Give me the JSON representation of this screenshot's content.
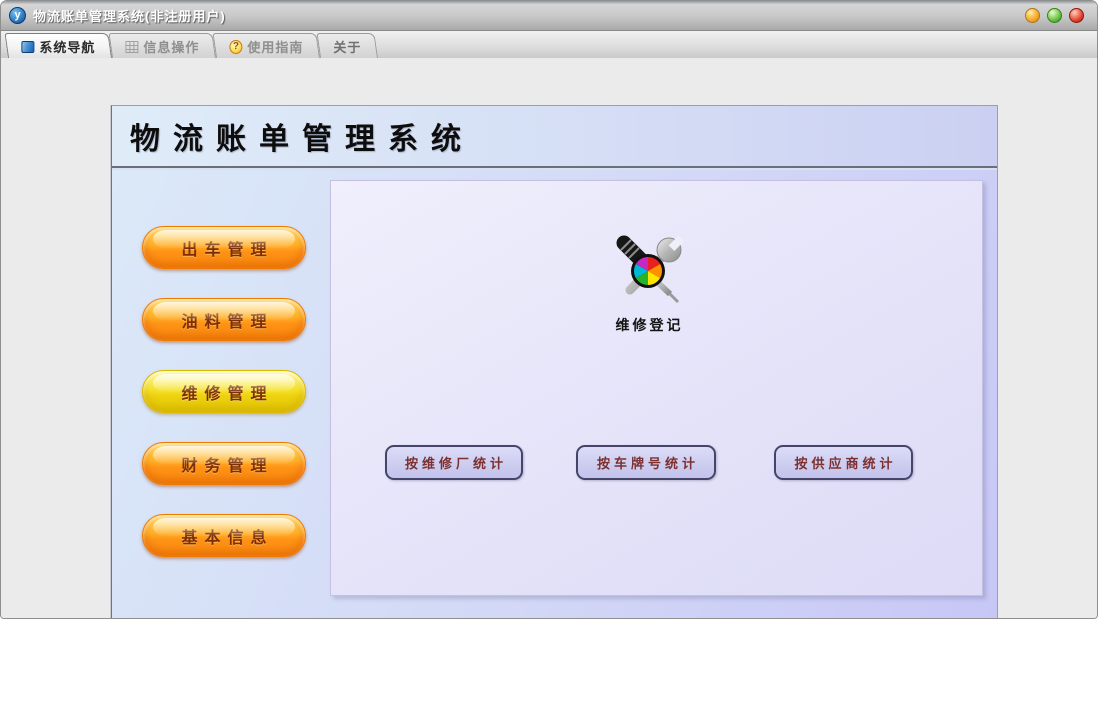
{
  "window": {
    "title": "物流账单管理系统(非注册用户)",
    "app_icon": "y-logo-icon",
    "controls": [
      {
        "name": "minimize",
        "color": "#eda020"
      },
      {
        "name": "restore",
        "color": "#58b838"
      },
      {
        "name": "close",
        "color": "#d83828"
      }
    ]
  },
  "tabs": [
    {
      "label": "系统导航",
      "icon": "monitor-icon",
      "active": true
    },
    {
      "label": "信息操作",
      "icon": "grid-icon",
      "active": false
    },
    {
      "label": "使用指南",
      "icon": "help-coin-icon",
      "active": false
    },
    {
      "label": "关于",
      "icon": "",
      "active": false
    }
  ],
  "help_icon_glyph": "?",
  "app_icon_glyph": "y",
  "panel": {
    "header_title": "物流账单管理系统",
    "sidebar_buttons": [
      {
        "label": "出车管理",
        "state": "normal"
      },
      {
        "label": "油料管理",
        "state": "normal"
      },
      {
        "label": "维修管理",
        "state": "selected"
      },
      {
        "label": "财务管理",
        "state": "normal"
      },
      {
        "label": "基本信息",
        "state": "normal"
      }
    ],
    "workspace": {
      "shortcut": {
        "label": "维修登记",
        "icon": "repair-tools-icon"
      },
      "stat_buttons": [
        {
          "label": "按维修厂统计"
        },
        {
          "label": "按车牌号统计"
        },
        {
          "label": "按供应商统计"
        }
      ]
    }
  },
  "colors": {
    "sidebar_button": "#ff9417",
    "sidebar_button_selected": "#eed312",
    "sidebar_button_text": "#7c2e06",
    "stat_button_fill": "#ccccf0",
    "stat_button_border": "#45456a",
    "stat_button_text": "#7c3030",
    "panel_header_gradient": [
      "#dfecf8",
      "#cbd0f2"
    ],
    "panel_body_gradient": [
      "#dbe9f8",
      "#c7c7f6"
    ],
    "content_background": "#ebebeb"
  }
}
